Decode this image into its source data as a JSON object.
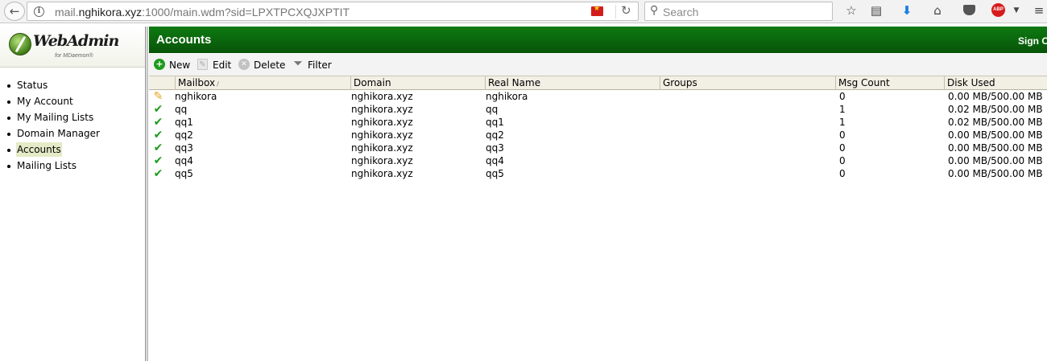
{
  "browser": {
    "url_prefix": "mail.",
    "url_host": "nghikora.xyz",
    "url_rest": ":1000/main.wdm?sid=LPXTPCXQJXPTIT",
    "search_placeholder": "Search",
    "abp_label": "ABP"
  },
  "sidebar": {
    "logo_text": "WebAdmin",
    "logo_subtext": "for MDaemon®",
    "items": [
      {
        "label": "Status",
        "active": false
      },
      {
        "label": "My Account",
        "active": false
      },
      {
        "label": "My Mailing Lists",
        "active": false
      },
      {
        "label": "Domain Manager",
        "active": false
      },
      {
        "label": "Accounts",
        "active": true
      },
      {
        "label": "Mailing Lists",
        "active": false
      }
    ]
  },
  "header": {
    "title": "Accounts",
    "signout_label": "Sign O"
  },
  "toolbar": {
    "new_label": "New",
    "edit_label": "Edit",
    "delete_label": "Delete",
    "filter_label": "Filter"
  },
  "table": {
    "columns": [
      "Mailbox",
      "Domain",
      "Real Name",
      "Groups",
      "Msg Count",
      "Disk Used"
    ],
    "sort_column": "Mailbox",
    "rows": [
      {
        "status": "admin",
        "mailbox": "nghikora",
        "domain": "nghikora.xyz",
        "real_name": "nghikora",
        "groups": "",
        "msg_count": "0",
        "disk_used": "0.00 MB/500.00 MB"
      },
      {
        "status": "enabled",
        "mailbox": "qq",
        "domain": "nghikora.xyz",
        "real_name": "qq",
        "groups": "",
        "msg_count": "1",
        "disk_used": "0.02 MB/500.00 MB"
      },
      {
        "status": "enabled",
        "mailbox": "qq1",
        "domain": "nghikora.xyz",
        "real_name": "qq1",
        "groups": "",
        "msg_count": "1",
        "disk_used": "0.02 MB/500.00 MB"
      },
      {
        "status": "enabled",
        "mailbox": "qq2",
        "domain": "nghikora.xyz",
        "real_name": "qq2",
        "groups": "",
        "msg_count": "0",
        "disk_used": "0.00 MB/500.00 MB"
      },
      {
        "status": "enabled",
        "mailbox": "qq3",
        "domain": "nghikora.xyz",
        "real_name": "qq3",
        "groups": "",
        "msg_count": "0",
        "disk_used": "0.00 MB/500.00 MB"
      },
      {
        "status": "enabled",
        "mailbox": "qq4",
        "domain": "nghikora.xyz",
        "real_name": "qq4",
        "groups": "",
        "msg_count": "0",
        "disk_used": "0.00 MB/500.00 MB"
      },
      {
        "status": "enabled",
        "mailbox": "qq5",
        "domain": "nghikora.xyz",
        "real_name": "qq5",
        "groups": "",
        "msg_count": "0",
        "disk_used": "0.00 MB/500.00 MB"
      }
    ]
  },
  "colors": {
    "header_green": "#0b6b0e",
    "active_highlight": "#e4ebc6",
    "status_green": "#1f9b1f"
  }
}
